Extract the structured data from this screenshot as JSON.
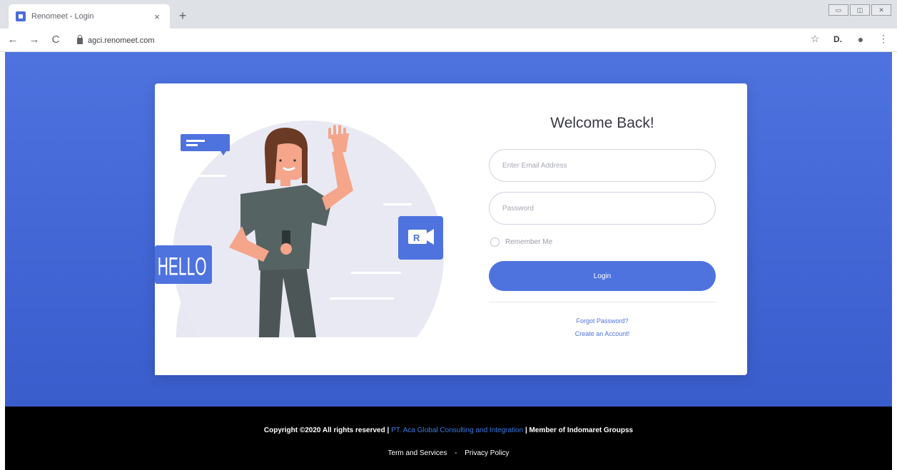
{
  "browser": {
    "tab_title": "Renomeet - Login",
    "tab_close": "×",
    "new_tab": "+",
    "url": "agci.renomeet.com",
    "back": "←",
    "forward": "→",
    "reload": "C",
    "window_controls": [
      "▭",
      "◫",
      "✕"
    ],
    "toolbar_icons": [
      "☆",
      "D.",
      "●",
      "⋮"
    ]
  },
  "illustration": {
    "hello_text": "HELLO",
    "camera_letter": "R"
  },
  "login": {
    "heading": "Welcome Back!",
    "email_placeholder": "Enter Email Address",
    "password_placeholder": "Password",
    "remember_label": "Remember Me",
    "login_button": "Login",
    "forgot_link": "Forgot Password?",
    "create_link": "Create an Account!"
  },
  "footer": {
    "copyright_prefix": "Copyright ©2020 All rights reserved | ",
    "company": "PT. Aca Global Consulting and Integration",
    "copyright_suffix": " | Member of Indomaret Groupss",
    "terms": "Term and Services",
    "separator": "-",
    "privacy": "Privacy Policy"
  },
  "colors": {
    "primary": "#4e73df",
    "footer_bg": "#000000"
  }
}
